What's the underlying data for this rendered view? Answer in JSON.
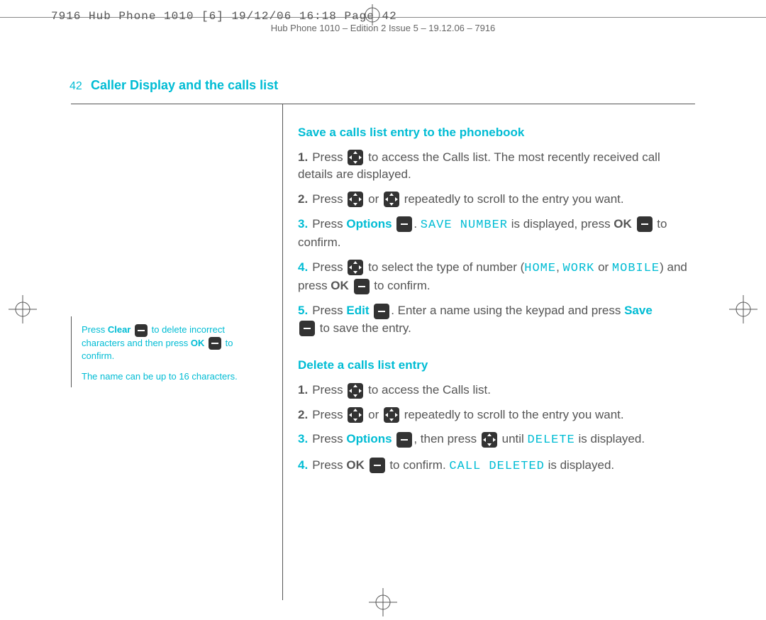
{
  "crop_header": "7916 Hub Phone 1010 [6]  19/12/06  16:18  Page 42",
  "running_head": "Hub Phone 1010 – Edition 2 Issue 5 – 19.12.06 – 7916",
  "page_number": "42",
  "section_title": "Caller Display and the calls list",
  "sidebar": {
    "note1_a": "Press ",
    "note1_clear": "Clear",
    "note1_b": " to delete incorrect characters and then press ",
    "note1_ok": "OK",
    "note1_c": " to confirm.",
    "note2": "The name can be up to 16 characters."
  },
  "save": {
    "heading": "Save a calls list entry to the phonebook",
    "step1_a": "Press ",
    "step1_b": " to access the Calls list. The most recently received call details are displayed.",
    "step2_a": "Press ",
    "step2_or": " or ",
    "step2_b": " repeatedly to scroll to the entry you want.",
    "step3_a": "Press ",
    "step3_options": "Options",
    "step3_b": ". ",
    "step3_lcd": "SAVE NUMBER",
    "step3_c": " is displayed, press ",
    "step3_ok": "OK",
    "step3_d": " to confirm.",
    "step4_a": "Press ",
    "step4_b": " to select the type of number (",
    "step4_home": "HOME",
    "step4_sep1": ", ",
    "step4_work": "WORK",
    "step4_sep2": " or ",
    "step4_mobile": "MOBILE",
    "step4_c": ") and press ",
    "step4_ok": "OK",
    "step4_d": " to confirm.",
    "step5_a": "Press ",
    "step5_edit": "Edit",
    "step5_b": ". Enter a name using the keypad and press ",
    "step5_save": "Save",
    "step5_c": " to save the entry."
  },
  "delete": {
    "heading": "Delete a calls list entry",
    "step1_a": "Press ",
    "step1_b": " to access the Calls list.",
    "step2_a": "Press ",
    "step2_or": " or ",
    "step2_b": " repeatedly to scroll to the entry you want.",
    "step3_a": "Press ",
    "step3_options": "Options",
    "step3_b": ", then press ",
    "step3_c": " until ",
    "step3_lcd": "DELETE",
    "step3_d": " is displayed.",
    "step4_a": "Press ",
    "step4_ok": "OK",
    "step4_b": " to confirm. ",
    "step4_lcd": "CALL DELETED",
    "step4_c": " is displayed."
  }
}
